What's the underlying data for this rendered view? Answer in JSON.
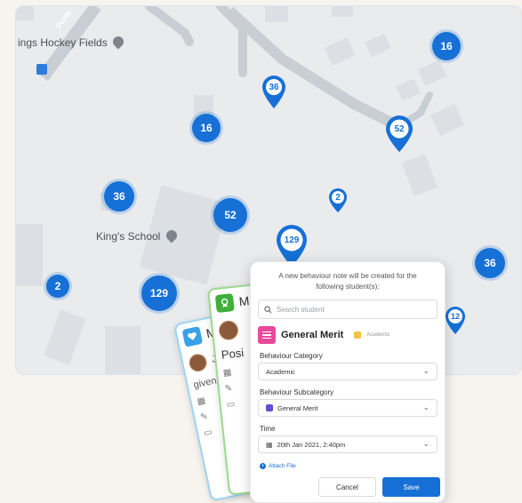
{
  "map": {
    "labels": {
      "hockey_fields": "ings Hockey Fields",
      "school": "King's School",
      "road": "Porte"
    },
    "clusters": [
      "16",
      "16",
      "36",
      "52",
      "129",
      "2",
      "36"
    ],
    "pins": [
      "36",
      "52",
      "2",
      "129",
      "12"
    ]
  },
  "back_cards": {
    "card1": {
      "title": "Me",
      "user_initial": "Jo",
      "text": "given"
    },
    "card2": {
      "title": "M",
      "text": "Posi"
    }
  },
  "modal": {
    "intro": "A new behaviour note will be created for the following student(s):",
    "search_placeholder": "Search student",
    "merit_title": "General Merit",
    "merit_tag": "Academic",
    "category_label": "Behaviour Category",
    "category_value": "Academic",
    "subcategory_label": "Behaviour Subcategory",
    "subcategory_value": "General Merit",
    "time_label": "Time",
    "time_value": "20th Jan 2021, 2:40pm",
    "attach_label": "Attach File",
    "cancel_label": "Cancel",
    "save_label": "Save"
  },
  "colors": {
    "accent": "#1670d6",
    "merit": "#e8499b",
    "card_blue": "#9fd3f5",
    "card_green": "#9bd98f"
  }
}
